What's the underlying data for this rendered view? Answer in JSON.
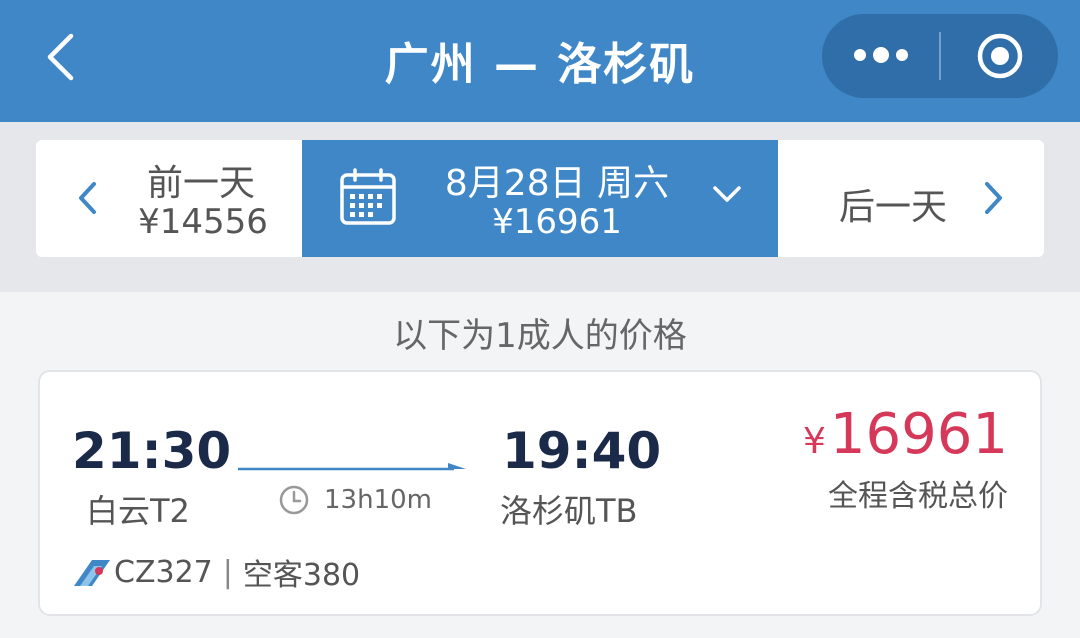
{
  "header": {
    "title": "广州 — 洛杉矶",
    "background": "#3f87c6",
    "back_icon": "chevron-left-icon",
    "more_icon": "more-dots-icon",
    "close_icon": "target-circle-icon"
  },
  "date_bar": {
    "prev": {
      "label": "前一天",
      "price": "¥14556"
    },
    "current": {
      "date": "8月28日 周六",
      "price": "¥16961",
      "calendar_icon": "calendar-icon",
      "dropdown_icon": "chevron-down-icon"
    },
    "next": {
      "label": "后一天"
    }
  },
  "note": "以下为1成人的价格",
  "flight": {
    "departure_time": "21:30",
    "departure_airport": "白云T2",
    "duration": "13h10m",
    "arrival_time": "19:40",
    "arrival_airport": "洛杉矶TB",
    "price_currency": "¥",
    "price_value": "16961",
    "price_note": "全程含税总价",
    "flight_number": "CZ327",
    "separator": "|",
    "aircraft": "空客380",
    "price_color": "#d6385a",
    "airline_logo_icon": "china-southern-logo-icon"
  }
}
